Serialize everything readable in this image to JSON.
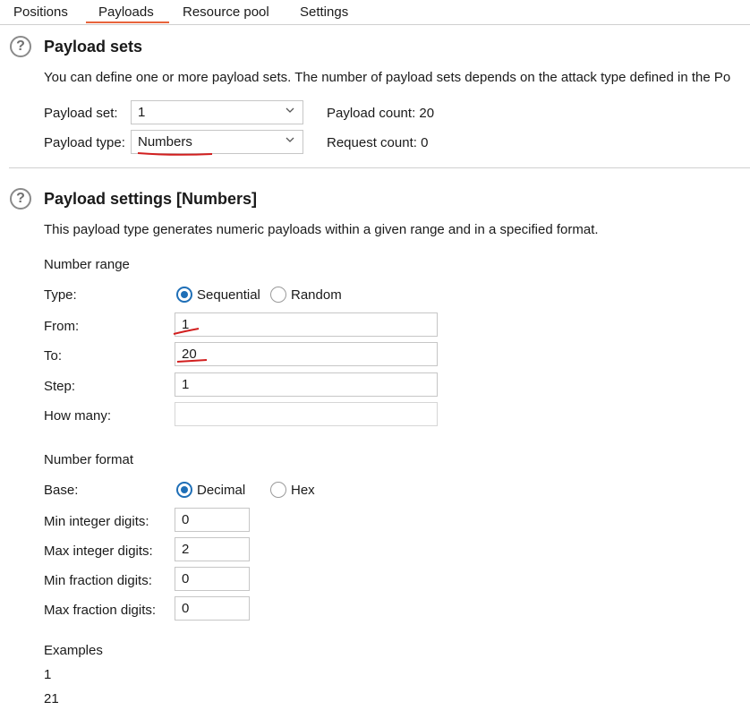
{
  "tabs": [
    "Positions",
    "Payloads",
    "Resource pool",
    "Settings"
  ],
  "payload_sets": {
    "title": "Payload sets",
    "description": "You can define one or more payload sets. The number of payload sets depends on the attack type defined in the Po",
    "payload_set_label": "Payload set:",
    "payload_set_value": "1",
    "payload_count_label": "Payload count: 20",
    "payload_type_label": "Payload type:",
    "payload_type_value": "Numbers",
    "request_count_label": "Request count: 0"
  },
  "payload_settings": {
    "title": "Payload settings [Numbers]",
    "description": "This payload type generates numeric payloads within a given range and in a specified format.",
    "number_range_label": "Number range",
    "type_label": "Type:",
    "type_options": [
      "Sequential",
      "Random"
    ],
    "type_selected": "Sequential",
    "from_label": "From:",
    "from_value": "1",
    "to_label": "To:",
    "to_value": "20",
    "step_label": "Step:",
    "step_value": "1",
    "how_many_label": "How many:",
    "how_many_value": "",
    "number_format_label": "Number format",
    "base_label": "Base:",
    "base_options": [
      "Decimal",
      "Hex"
    ],
    "base_selected": "Decimal",
    "min_int_label": "Min integer digits:",
    "min_int_value": "0",
    "max_int_label": "Max integer digits:",
    "max_int_value": "2",
    "min_frac_label": "Min fraction digits:",
    "min_frac_value": "0",
    "max_frac_label": "Max fraction digits:",
    "max_frac_value": "0",
    "examples_label": "Examples",
    "examples": [
      "1",
      "21"
    ]
  },
  "colors": {
    "accent_tab": "#e8643c",
    "radio_selected": "#1f6fb7",
    "annotation": "#d21f1f"
  }
}
